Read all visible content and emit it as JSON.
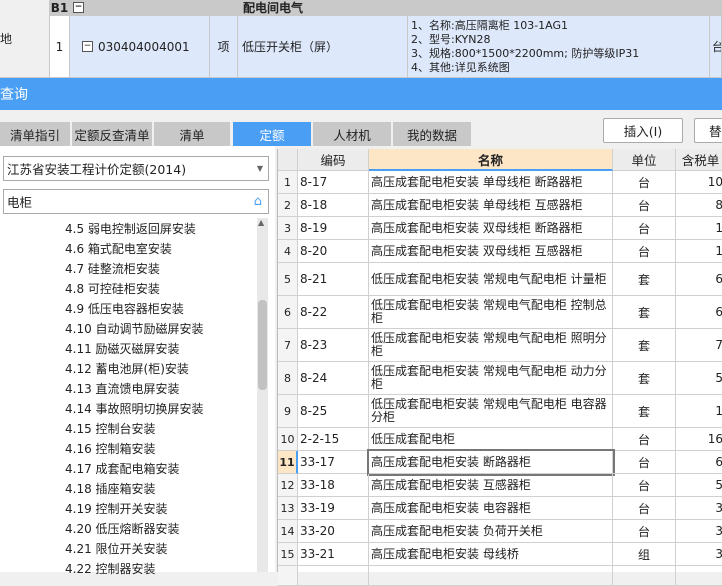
{
  "top_grid": {
    "left_label": "地",
    "header": {
      "code": "B1",
      "name": "配电间电气"
    },
    "row": {
      "num": "1",
      "code": "030404004001",
      "type": "项",
      "name": "低压开关柜（屏）",
      "desc": [
        "1、名称:高压隔离柜 103-1AG1",
        "2、型号:KYN28",
        "3、规格:800*1500*2200mm; 防护等级IP31",
        "4、其他:详见系统图"
      ],
      "unit": "台"
    }
  },
  "panel_title": "查询",
  "tabs": [
    "清单指引",
    "定额反查清单",
    "清单",
    "定额",
    "人材机",
    "我的数据"
  ],
  "active_tab": 3,
  "buttons": {
    "insert": "插入(I)",
    "replace": "替"
  },
  "left": {
    "quota_select": "江苏省安装工程计价定额(2014)",
    "search_value": "电柜",
    "tree": [
      "4.5 弱电控制返回屏安装",
      "4.6 箱式配电室安装",
      "4.7 硅整流柜安装",
      "4.8 可控硅柜安装",
      "4.9 低压电容器柜安装",
      "4.10 自动调节励磁屏安装",
      "4.11 励磁灭磁屏安装",
      "4.12 蓄电池屏(柜)安装",
      "4.13 直流馈电屏安装",
      "4.14 事故照明切换屏安装",
      "4.15 控制台安装",
      "4.16 控制箱安装",
      "4.17 成套配电箱安装",
      "4.18 插座箱安装",
      "4.19 控制开关安装",
      "4.20 低压熔断器安装",
      "4.21 限位开关安装",
      "4.22 控制器安装"
    ]
  },
  "table": {
    "headers": [
      "编码",
      "名称",
      "单位",
      "含税单"
    ],
    "selected_row": 11,
    "rows": [
      {
        "n": "1",
        "code": "8-17",
        "name": "高压成套配电柜安装 单母线柜 断路器柜",
        "unit": "台",
        "price": "10"
      },
      {
        "n": "2",
        "code": "8-18",
        "name": "高压成套配电柜安装 单母线柜 互感器柜",
        "unit": "台",
        "price": "8"
      },
      {
        "n": "3",
        "code": "8-19",
        "name": "高压成套配电柜安装 双母线柜 断路器柜",
        "unit": "台",
        "price": "1"
      },
      {
        "n": "4",
        "code": "8-20",
        "name": "高压成套配电柜安装 双母线柜 互感器柜",
        "unit": "台",
        "price": "1"
      },
      {
        "n": "5",
        "code": "8-21",
        "name": "低压成套配电柜安装 常规电气配电柜 计量柜",
        "unit": "套",
        "price": "6"
      },
      {
        "n": "6",
        "code": "8-22",
        "name": "低压成套配电柜安装 常规电气配电柜 控制总柜",
        "unit": "套",
        "price": "6"
      },
      {
        "n": "7",
        "code": "8-23",
        "name": "低压成套配电柜安装 常规电气配电柜 照明分柜",
        "unit": "套",
        "price": "7"
      },
      {
        "n": "8",
        "code": "8-24",
        "name": "低压成套配电柜安装 常规电气配电柜 动力分柜",
        "unit": "套",
        "price": "5"
      },
      {
        "n": "9",
        "code": "8-25",
        "name": "低压成套配电柜安装 常规电气配电柜 电容器分柜",
        "unit": "套",
        "price": "1"
      },
      {
        "n": "10",
        "code": "2-2-15",
        "name": "低压成套配电柜",
        "unit": "台",
        "price": "16"
      },
      {
        "n": "11",
        "code": "33-17",
        "name": "高压成套配电柜安装 断路器柜",
        "unit": "台",
        "price": "6"
      },
      {
        "n": "12",
        "code": "33-18",
        "name": "高压成套配电柜安装 互感器柜",
        "unit": "台",
        "price": "5"
      },
      {
        "n": "13",
        "code": "33-19",
        "name": "高压成套配电柜安装 电容器柜",
        "unit": "台",
        "price": "3"
      },
      {
        "n": "14",
        "code": "33-20",
        "name": "高压成套配电柜安装 负荷开关柜",
        "unit": "台",
        "price": "3"
      },
      {
        "n": "15",
        "code": "33-21",
        "name": "高压成套配电柜安装 母线桥",
        "unit": "组",
        "price": "3"
      }
    ]
  }
}
